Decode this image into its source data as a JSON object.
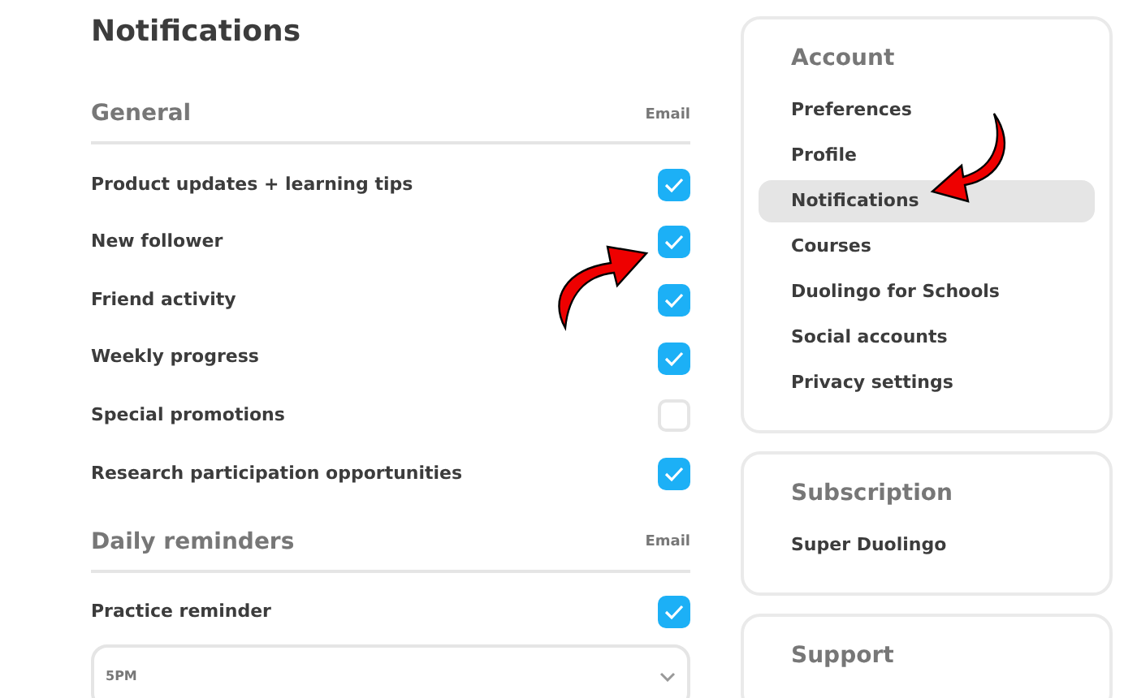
{
  "title": "Notifications",
  "sections": [
    {
      "heading": "General",
      "column": "Email",
      "rows": [
        {
          "label": "Product updates + learning tips",
          "checked": true
        },
        {
          "label": "New follower",
          "checked": true
        },
        {
          "label": "Friend activity",
          "checked": true
        },
        {
          "label": "Weekly progress",
          "checked": true
        },
        {
          "label": "Special promotions",
          "checked": false
        },
        {
          "label": "Research participation opportunities",
          "checked": true
        }
      ]
    },
    {
      "heading": "Daily reminders",
      "column": "Email",
      "rows": [
        {
          "label": "Practice reminder",
          "checked": true
        }
      ],
      "dropdown": {
        "value": "5PM"
      }
    }
  ],
  "sidebar": [
    {
      "heading": "Account",
      "items": [
        {
          "label": "Preferences",
          "selected": false
        },
        {
          "label": "Profile",
          "selected": false
        },
        {
          "label": "Notifications",
          "selected": true
        },
        {
          "label": "Courses",
          "selected": false
        },
        {
          "label": "Duolingo for Schools",
          "selected": false
        },
        {
          "label": "Social accounts",
          "selected": false
        },
        {
          "label": "Privacy settings",
          "selected": false
        }
      ]
    },
    {
      "heading": "Subscription",
      "items": [
        {
          "label": "Super Duolingo",
          "selected": false
        }
      ]
    },
    {
      "heading": "Support"
    }
  ]
}
